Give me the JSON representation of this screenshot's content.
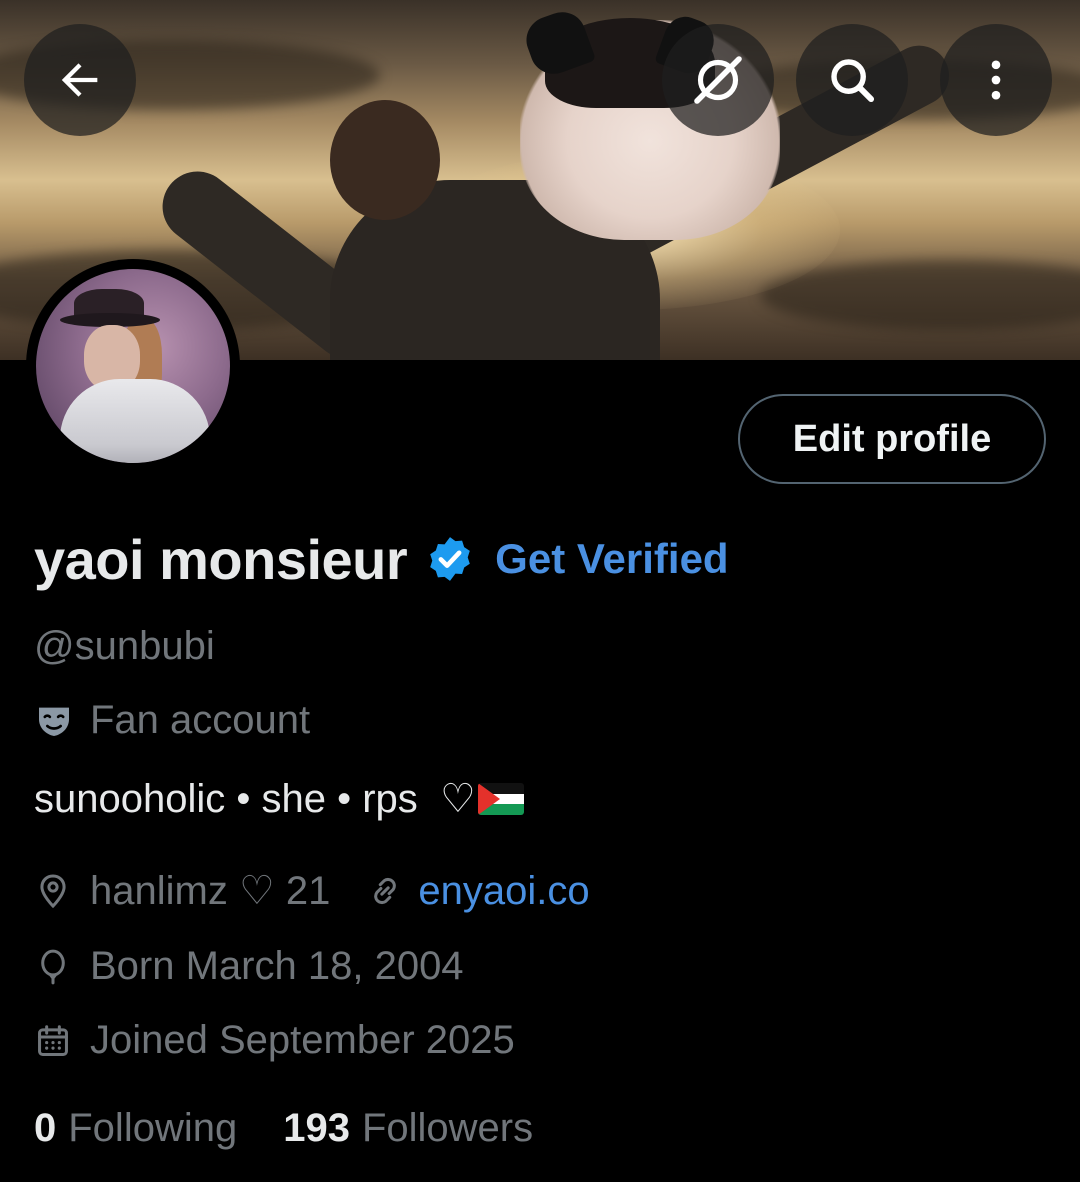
{
  "header": {
    "back_icon": "arrow-left-icon",
    "grok_icon": "grok-icon",
    "search_icon": "search-icon",
    "more_icon": "more-vertical-icon"
  },
  "profile": {
    "display_name": "yaoi monsieur",
    "verified_badge_color": "#1d9bf0",
    "get_verified_label": "Get Verified",
    "handle": "@sunbubi",
    "category": "Fan account",
    "bio": "sunooholic • she • rps  ♡",
    "location": "hanlimz ♡ 21",
    "website": "enyaoi.co",
    "birthday": "Born March 18, 2004",
    "joined": "Joined September 2025"
  },
  "actions": {
    "edit_profile_label": "Edit profile"
  },
  "stats": {
    "following_count": "0",
    "following_label": "Following",
    "followers_count": "193",
    "followers_label": "Followers"
  },
  "colors": {
    "background": "#000000",
    "accent_link": "#4a90e2",
    "muted_text": "#71767b",
    "primary_text": "#e7e9ea"
  }
}
